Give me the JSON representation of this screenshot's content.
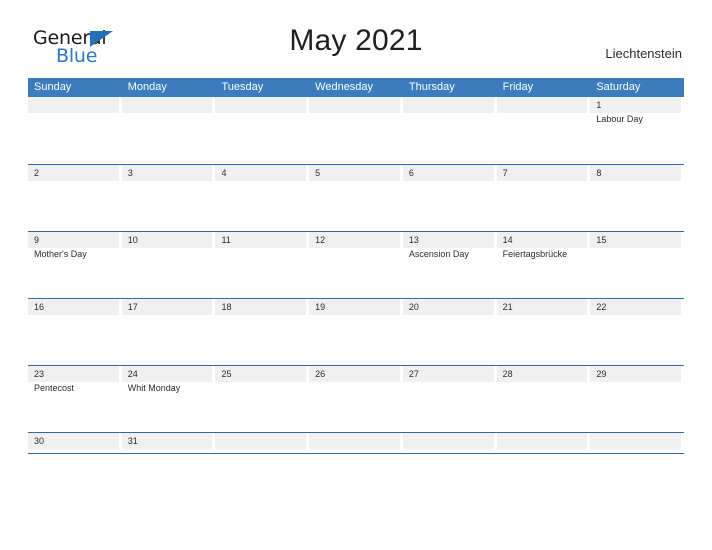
{
  "header": {
    "logo": {
      "word1": "General",
      "word2": "Blue",
      "flag_icon": "triangle-flag-icon",
      "accent_color": "#2173b5"
    },
    "title": "May 2021",
    "region": "Liechtenstein"
  },
  "calendar": {
    "header_bg": "#3a7cbd",
    "row_line_color": "#2d6ca8",
    "date_band_color": "#f0f0f0",
    "day_names": [
      "Sunday",
      "Monday",
      "Tuesday",
      "Wednesday",
      "Thursday",
      "Friday",
      "Saturday"
    ],
    "weeks": [
      [
        {
          "date": "",
          "events": []
        },
        {
          "date": "",
          "events": []
        },
        {
          "date": "",
          "events": []
        },
        {
          "date": "",
          "events": []
        },
        {
          "date": "",
          "events": []
        },
        {
          "date": "",
          "events": []
        },
        {
          "date": "1",
          "events": [
            "Labour Day"
          ]
        }
      ],
      [
        {
          "date": "2",
          "events": []
        },
        {
          "date": "3",
          "events": []
        },
        {
          "date": "4",
          "events": []
        },
        {
          "date": "5",
          "events": []
        },
        {
          "date": "6",
          "events": []
        },
        {
          "date": "7",
          "events": []
        },
        {
          "date": "8",
          "events": []
        }
      ],
      [
        {
          "date": "9",
          "events": [
            "Mother's Day"
          ]
        },
        {
          "date": "10",
          "events": []
        },
        {
          "date": "11",
          "events": []
        },
        {
          "date": "12",
          "events": []
        },
        {
          "date": "13",
          "events": [
            "Ascension Day"
          ]
        },
        {
          "date": "14",
          "events": [
            "Feiertagsbrücke"
          ]
        },
        {
          "date": "15",
          "events": []
        }
      ],
      [
        {
          "date": "16",
          "events": []
        },
        {
          "date": "17",
          "events": []
        },
        {
          "date": "18",
          "events": []
        },
        {
          "date": "19",
          "events": []
        },
        {
          "date": "20",
          "events": []
        },
        {
          "date": "21",
          "events": []
        },
        {
          "date": "22",
          "events": []
        }
      ],
      [
        {
          "date": "23",
          "events": [
            "Pentecost"
          ]
        },
        {
          "date": "24",
          "events": [
            "Whit Monday"
          ]
        },
        {
          "date": "25",
          "events": []
        },
        {
          "date": "26",
          "events": []
        },
        {
          "date": "27",
          "events": []
        },
        {
          "date": "28",
          "events": []
        },
        {
          "date": "29",
          "events": []
        }
      ],
      [
        {
          "date": "30",
          "events": []
        },
        {
          "date": "31",
          "events": []
        },
        {
          "date": "",
          "events": []
        },
        {
          "date": "",
          "events": []
        },
        {
          "date": "",
          "events": []
        },
        {
          "date": "",
          "events": []
        },
        {
          "date": "",
          "events": []
        }
      ]
    ]
  }
}
